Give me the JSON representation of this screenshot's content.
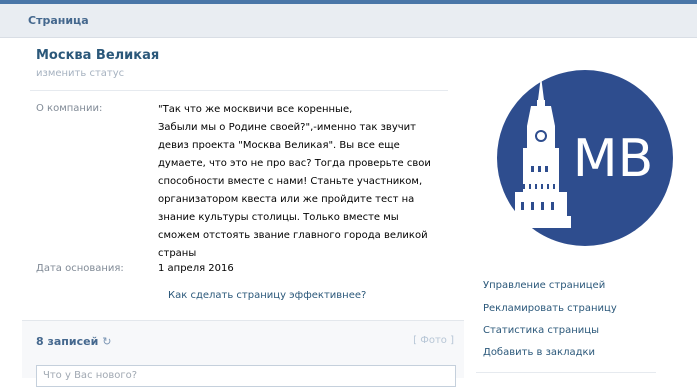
{
  "header": {
    "title": "Страница"
  },
  "page": {
    "name": "Москва Великая",
    "status_link": "изменить статус"
  },
  "info": {
    "about_label": "О компании:",
    "about_text": "\"Так что же москвичи все коренные,\nЗабыли мы о Родине своей?\",-именно так звучит\nдевиз проекта \"Москва Великая\". Вы все еще\nдумаете, что это не про вас? Тогда проверьте свои\nспособности вместе с нами! Станьте участником,\nорганизатором квеста или же пройдите тест на\nзнание культуры столицы. Только вместе мы\nсможем отстоять звание главного города великой\nстраны",
    "founded_label": "Дата основания:",
    "founded_value": "1 апреля 2016",
    "effective_link": "Как сделать страницу эффективнее?"
  },
  "posts": {
    "count_label": "8 записей",
    "refresh_icon": "↻",
    "photo_link": "[ Фото ]",
    "input_placeholder": "Что у Вас нового?"
  },
  "logo": {
    "initials": "МВ",
    "colors": {
      "circle": "#2e4d8e",
      "foreground": "#ffffff"
    }
  },
  "sidebar": {
    "links": [
      "Управление страницей",
      "Рекламировать страницу",
      "Статистика страницы",
      "Добавить в закладки"
    ]
  },
  "colors": {
    "accent": "#4a76a8",
    "link": "#2b587a",
    "header_bg": "#e9edf2"
  }
}
